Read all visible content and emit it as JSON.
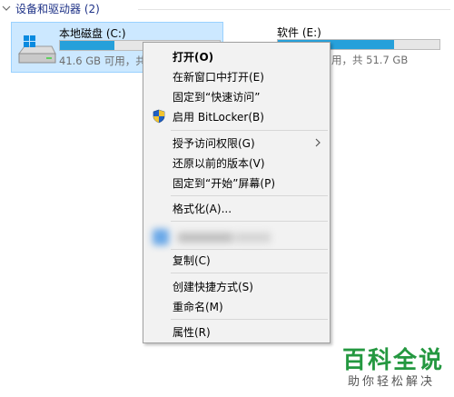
{
  "group": {
    "title": "设备和驱动器 (2)"
  },
  "drives": [
    {
      "name": "本地磁盘 (C:)",
      "free_text": "41.6 GB 可用，共",
      "used_fraction": 0.34,
      "selected": true
    },
    {
      "name": "软件 (E:)",
      "free_text": "用，共 51.7 GB",
      "used_fraction": 0.72,
      "selected": false
    }
  ],
  "menu": {
    "items": {
      "open": "打开(O)",
      "open_new_window": "在新窗口中打开(E)",
      "pin_quick_access": "固定到“快速访问”",
      "bitlocker": "启用 BitLocker(B)",
      "grant_access": "授予访问权限(G)",
      "restore_versions": "还原以前的版本(V)",
      "pin_start": "固定到“开始”屏幕(P)",
      "format": "格式化(A)...",
      "copy": "复制(C)",
      "create_shortcut": "创建快捷方式(S)",
      "rename": "重命名(M)",
      "properties": "属性(R)"
    }
  },
  "icons": {
    "drive": "windows-drive-icon",
    "bitlocker": "uac-shield-icon",
    "submenu": "chevron-right-icon",
    "group_toggle": "chevron-down-icon"
  },
  "colors": {
    "accent_bar": "#26a0da",
    "selection_bg": "#cce8ff",
    "group_title": "#1e3287",
    "watermark": "#249840"
  },
  "watermark": {
    "title": "百科全说",
    "subtitle": "助你轻松解决"
  }
}
